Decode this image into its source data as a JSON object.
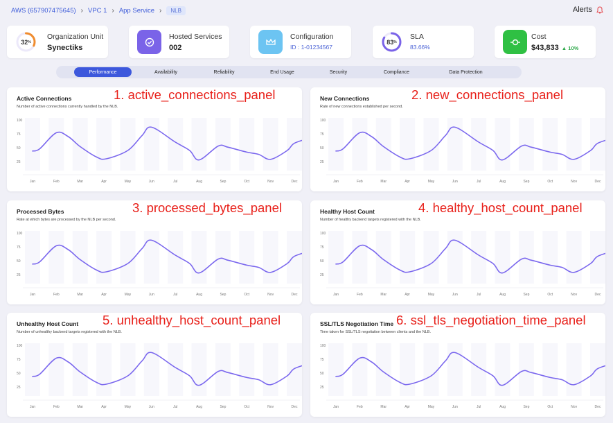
{
  "breadcrumb": {
    "account": "AWS (657907475645)",
    "vpc": "VPC 1",
    "app": "App Service",
    "current": "NLB"
  },
  "header": {
    "alerts_label": "Alerts"
  },
  "cards": {
    "org": {
      "percent": "32",
      "percent_sign": "%",
      "label": "Organization Unit",
      "value": "Synectiks"
    },
    "hosted": {
      "label": "Hosted Services",
      "value": "002"
    },
    "config": {
      "label": "Configuration",
      "value": "ID : 1-01234567"
    },
    "sla": {
      "percent": "83",
      "percent_sign": "%",
      "label": "SLA",
      "value": "83.66%"
    },
    "cost": {
      "label": "Cost",
      "value": "$43,833",
      "trend": "▲ 10%"
    }
  },
  "colors": {
    "accent": "#3d58dc",
    "line": "#7b68ee",
    "cost_green": "#2ea84a",
    "annotation": "#e8201a"
  },
  "tabs": [
    "Performance",
    "Availability",
    "Reliability",
    "End Usage",
    "Security",
    "Compliance",
    "Data Protection"
  ],
  "active_tab": "Performance",
  "panels": [
    {
      "title": "Active Connections",
      "description": "Number of active connections currently handled by the NLB.",
      "annotation": "1. active_connections_panel"
    },
    {
      "title": "New Connections",
      "description": "Rate of new connections established per second.",
      "annotation": "2. new_connections_panel"
    },
    {
      "title": "Processed Bytes",
      "description": "Rate at which bytes are processed by the NLB per second.",
      "annotation": "3. processed_bytes_panel"
    },
    {
      "title": "Healthy Host Count",
      "description": "Number of healthy backend targets registered with the NLB.",
      "annotation": "4. healthy_host_count_panel"
    },
    {
      "title": "Unhealthy Host Count",
      "description": "Number of unhealthy backend targets registered with the NLB.",
      "annotation": "5. unhealthy_host_count_panel"
    },
    {
      "title": "SSL/TLS Negotiation Time",
      "description": "Time taken for SSL/TLS negotiation between clients and the NLB.",
      "annotation": "6. ssl_tls_negotiation_time_panel"
    }
  ],
  "chart_data": {
    "type": "line",
    "categories": [
      "Jan",
      "Feb",
      "Mar",
      "Apr",
      "May",
      "Jun",
      "Jul",
      "Aug",
      "Sep",
      "Oct",
      "Nov",
      "Dec"
    ],
    "y_ticks": [
      "100",
      "75",
      "50",
      "25"
    ],
    "ylim": [
      0,
      100
    ],
    "x": [
      0,
      0.3,
      1,
      1.5,
      2,
      2.7,
      3.1,
      4,
      4.6,
      5,
      6,
      6.6,
      7,
      7.8,
      8.2,
      9,
      9.5,
      10,
      10.7,
      11,
      11.7
    ],
    "values": [
      44,
      48,
      77,
      70,
      52,
      33,
      30,
      45,
      72,
      87,
      60,
      45,
      28,
      53,
      51,
      42,
      38,
      29,
      45,
      58,
      68
    ],
    "grid": true
  }
}
